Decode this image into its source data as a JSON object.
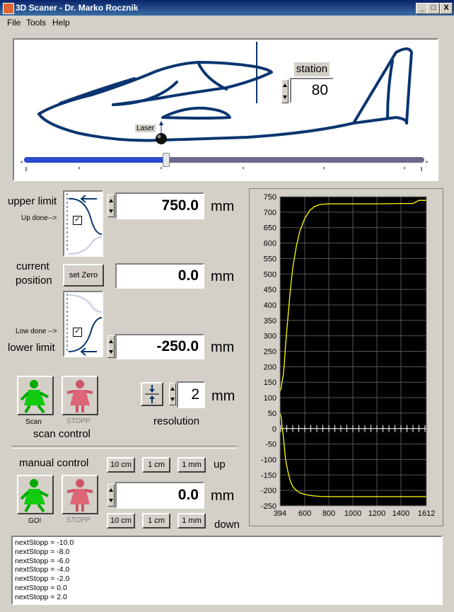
{
  "window": {
    "title": "3D Scaner - Dr. Marko Rocznik",
    "minimize": "_",
    "maximize": "□",
    "close": "X"
  },
  "menu": [
    "File",
    "Tools",
    "Help"
  ],
  "station": {
    "label": "station",
    "value": "80"
  },
  "laser_label": "Laser",
  "upper_limit": {
    "label": "upper limit",
    "done_label": "Up done-->",
    "value": "750.0",
    "unit": "mm",
    "checked": true
  },
  "current_position": {
    "label_line1": "current",
    "label_line2": "position",
    "button": "set Zero",
    "value": "0.0",
    "unit": "mm"
  },
  "lower_limit": {
    "label": "lower limit",
    "done_label": "Low done -->",
    "value": "-250.0",
    "unit": "mm",
    "checked": true
  },
  "scan_control": {
    "scan_label": "Scan",
    "stop_label": "STOPP",
    "title": "scan control"
  },
  "resolution": {
    "value": "2",
    "unit": "mm",
    "label": "resolution"
  },
  "manual_control": {
    "label": "manual control",
    "up_buttons": [
      "10 cm",
      "1 cm",
      "1 mm"
    ],
    "up_label": "up",
    "down_buttons": [
      "10 cm",
      "1 cm",
      "1 mm"
    ],
    "down_label": "down",
    "go_label": "GO!",
    "stop_label": "STOPP",
    "value": "0.0",
    "unit": "mm"
  },
  "chart_data": {
    "type": "line",
    "x_ticks": [
      "394",
      "600",
      "800",
      "1000",
      "1200",
      "1400",
      "1612"
    ],
    "y_ticks": [
      "750",
      "700",
      "650",
      "600",
      "550",
      "500",
      "450",
      "400",
      "350",
      "300",
      "250",
      "200",
      "150",
      "100",
      "50",
      "0",
      "-50",
      "-100",
      "-150",
      "-200",
      "-250"
    ],
    "xlim": [
      394,
      1612
    ],
    "ylim": [
      -250,
      750
    ],
    "grid": true,
    "background": "#000000",
    "line_color": "#ffff00",
    "series": [
      {
        "x": [
          394,
          400,
          405,
          410,
          420,
          430,
          440,
          460,
          480,
          500,
          530,
          560,
          600,
          640,
          680,
          720,
          760,
          800,
          1000,
          1200,
          1400,
          1500,
          1550,
          1612
        ],
        "y": [
          120,
          128,
          135,
          150,
          170,
          210,
          270,
          360,
          450,
          520,
          590,
          640,
          680,
          705,
          718,
          724,
          726,
          727,
          727,
          727,
          728,
          728,
          738,
          738
        ]
      },
      {
        "x": [
          394,
          400,
          405,
          410,
          420,
          430,
          440,
          460,
          480,
          500,
          530,
          560,
          600,
          640,
          680,
          720,
          760,
          800,
          1000,
          1200,
          1400,
          1500,
          1550,
          1612
        ],
        "y": [
          50,
          42,
          35,
          10,
          -20,
          -60,
          -100,
          -140,
          -170,
          -188,
          -200,
          -208,
          -213,
          -216,
          -218,
          -219,
          -220,
          -220,
          -220,
          -220,
          -220,
          -220,
          -220,
          -220
        ]
      }
    ]
  },
  "log_lines": [
    "nextStopp = -10.0",
    "nextStopp = -8.0",
    "nextStopp = -6.0",
    "nextStopp = -4.0",
    "nextStopp = -2.0",
    "nextStopp = 0.0",
    "nextStopp = 2.0"
  ]
}
